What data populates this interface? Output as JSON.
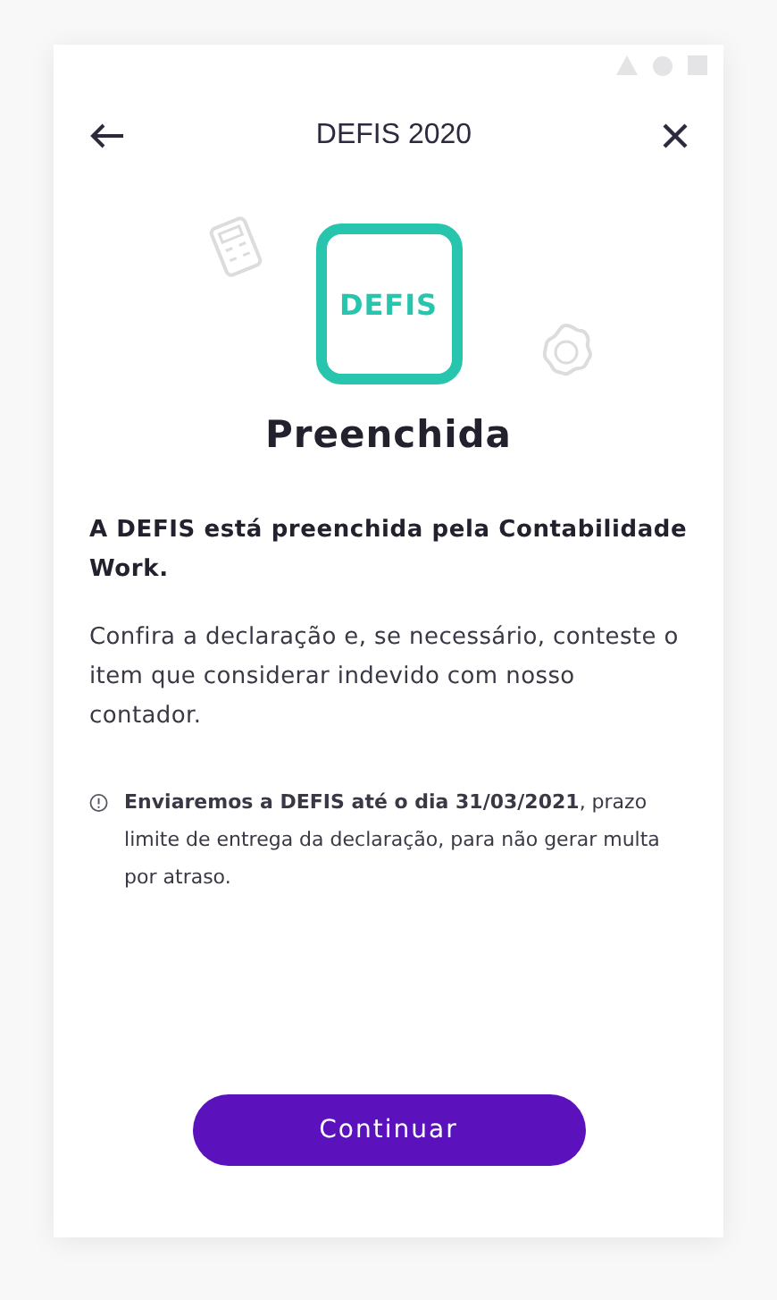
{
  "header": {
    "title": "DEFIS 2020"
  },
  "document": {
    "label": "DEFIS"
  },
  "status": {
    "title": "Preenchida"
  },
  "intro": "A DEFIS está preenchida pela Contabilidade Work.",
  "body": "Confira a declaração e, se necessário, conteste o item que considerar indevido com nosso contador.",
  "notice": "**Enviaremos a DEFIS até o dia 31/03/2021**, prazo limite de entrega da declaração, para não gerar multa por atraso.",
  "button": {
    "label": "Continuar"
  }
}
